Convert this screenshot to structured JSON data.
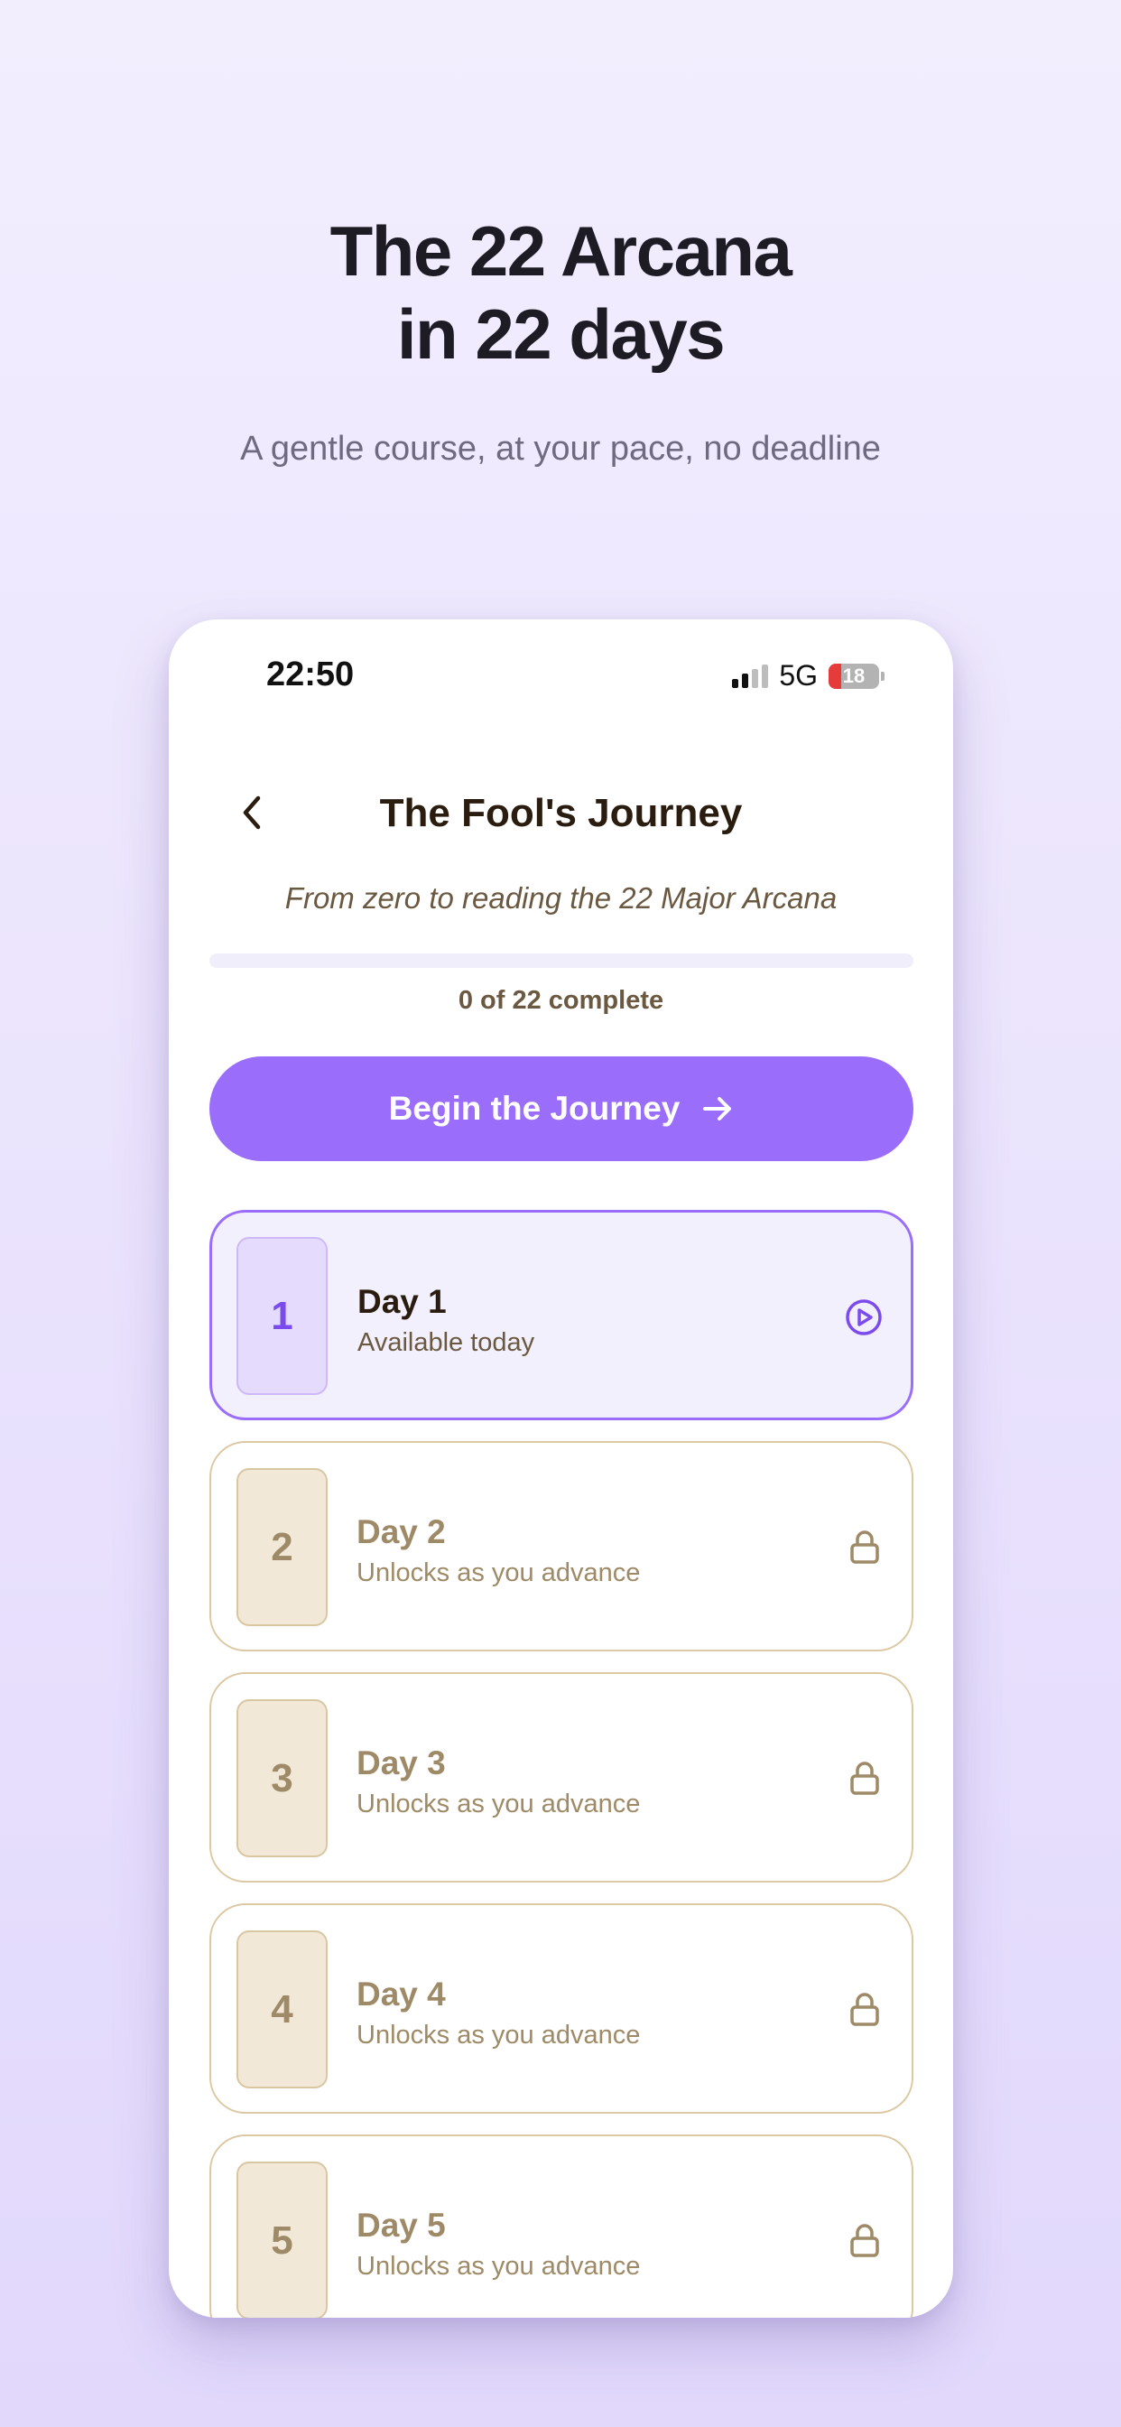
{
  "hero": {
    "title_line1": "The 22 Arcana",
    "title_line2": "in 22 days",
    "subtitle": "A gentle course, at your pace, no deadline"
  },
  "status_bar": {
    "time": "22:50",
    "network": "5G",
    "battery": "18"
  },
  "screen": {
    "title": "The Fool's Journey",
    "subtitle": "From zero to reading the 22 Major Arcana",
    "progress_fraction": 0,
    "progress_label": "0 of 22 complete",
    "begin_button": "Begin the Journey"
  },
  "days": [
    {
      "number": "1",
      "title": "Day 1",
      "status": "Available today",
      "state": "available",
      "icon": "play-icon"
    },
    {
      "number": "2",
      "title": "Day 2",
      "status": "Unlocks as you advance",
      "state": "locked",
      "icon": "lock-icon"
    },
    {
      "number": "3",
      "title": "Day 3",
      "status": "Unlocks as you advance",
      "state": "locked",
      "icon": "lock-icon"
    },
    {
      "number": "4",
      "title": "Day 4",
      "status": "Unlocks as you advance",
      "state": "locked",
      "icon": "lock-icon"
    },
    {
      "number": "5",
      "title": "Day 5",
      "status": "Unlocks as you advance",
      "state": "locked",
      "icon": "lock-icon"
    }
  ],
  "colors": {
    "accent": "#9b6dfb",
    "locked": "#9e8a66",
    "background": "#ece5fd"
  }
}
